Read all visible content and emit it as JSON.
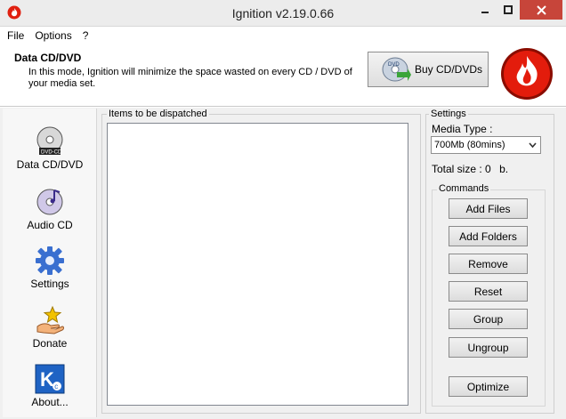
{
  "window": {
    "title": "Ignition v2.19.0.66",
    "accent_close": "#c7453a"
  },
  "menu": {
    "items": [
      "File",
      "Options",
      "?"
    ]
  },
  "header": {
    "mode_title": "Data CD/DVD",
    "mode_description": "In this mode, Ignition will minimize the space wasted on every CD / DVD of your media set.",
    "buy_button_label": "Buy CD/DVDs",
    "buy_button_icon": "dvd-disc-icon",
    "logo_icon": "flame-logo-icon"
  },
  "sidebar": {
    "items": [
      {
        "label": "Data CD/DVD",
        "icon": "dvd-cd-icon"
      },
      {
        "label": "Audio CD",
        "icon": "audio-cd-icon"
      },
      {
        "label": "Settings",
        "icon": "gear-icon"
      },
      {
        "label": "Donate",
        "icon": "donate-hand-icon"
      },
      {
        "label": "About...",
        "icon": "about-k-icon"
      }
    ]
  },
  "items_panel": {
    "legend": "Items to be dispatched",
    "items": []
  },
  "settings": {
    "legend": "Settings",
    "media_type_label": "Media Type :",
    "media_type_value": "700Mb (80mins)",
    "total_size_label": "Total size :",
    "total_size_value": "0",
    "total_size_unit": "b.",
    "commands_legend": "Commands",
    "commands": [
      "Add Files",
      "Add Folders",
      "Remove",
      "Reset",
      "Group",
      "Ungroup",
      "Optimize"
    ]
  }
}
